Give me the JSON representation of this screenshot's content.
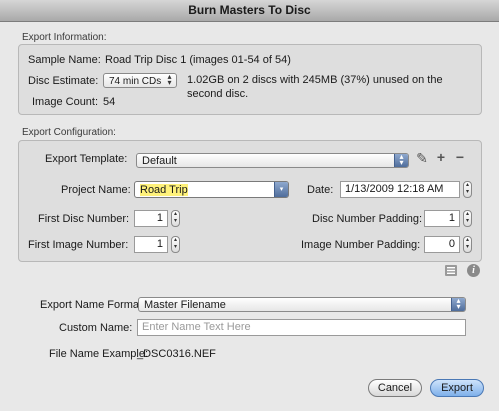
{
  "window": {
    "title": "Burn Masters To Disc"
  },
  "export_information": {
    "section_label": "Export Information:",
    "sample_name_label": "Sample Name:",
    "sample_name_value": "Road Trip Disc 1 (images 01-54 of 54)",
    "disc_estimate_label": "Disc Estimate:",
    "disc_estimate_selected": "74 min CDs",
    "disc_estimate_line1": "1.02GB on 2 discs with 245MB (37%) unused on the",
    "disc_estimate_line2": "second disc.",
    "image_count_label": "Image Count:",
    "image_count_value": "54"
  },
  "export_configuration": {
    "section_label": "Export Configuration:",
    "export_template_label": "Export Template:",
    "export_template_selected": "Default",
    "project_name_label": "Project Name:",
    "project_name_value": "Road Trip",
    "date_label": "Date:",
    "date_value": "1/13/2009 12:18 AM",
    "first_disc_number_label": "First Disc Number:",
    "first_disc_number_value": "1",
    "disc_number_padding_label": "Disc Number Padding:",
    "disc_number_padding_value": "1",
    "first_image_number_label": "First Image Number:",
    "first_image_number_value": "1",
    "image_number_padding_label": "Image Number Padding:",
    "image_number_padding_value": "0"
  },
  "naming": {
    "export_name_format_label": "Export Name Format:",
    "export_name_format_selected": "Master Filename",
    "custom_name_label": "Custom Name:",
    "custom_name_placeholder": "Enter Name Text Here",
    "file_name_example_label": "File Name Example:",
    "file_name_example_value": "_DSC0316.NEF"
  },
  "buttons": {
    "cancel": "Cancel",
    "export": "Export"
  },
  "icons": {
    "edit": "pencil-icon",
    "add": "plus-icon",
    "remove": "minus-icon",
    "list": "list-icon",
    "info": "info-icon"
  }
}
